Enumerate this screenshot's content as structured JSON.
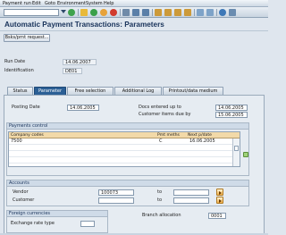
{
  "menu": [
    "Payment run",
    "Edit",
    "Goto",
    "Environment",
    "System",
    "Help"
  ],
  "toolbar": {
    "icons": [
      "enter-icon",
      "save-icon",
      "back-icon",
      "exit-icon",
      "cancel-icon",
      "print-icon",
      "find-icon",
      "find-next-icon",
      "first-page-icon",
      "previous-page-icon",
      "next-page-icon",
      "last-page-icon",
      "new-session-icon",
      "shortcut-icon",
      "help-icon",
      "layout-icon"
    ]
  },
  "title": "Automatic Payment Transactions: Parameters",
  "app_toolbar": {
    "print_request_label": "Bsks/prnt request..."
  },
  "header": {
    "run_date_label": "Run Date",
    "run_date_value": "14.06.2007",
    "identification_label": "Identification",
    "identification_value": "DE01"
  },
  "tabs": [
    {
      "label": "Status",
      "active": false
    },
    {
      "label": "Parameter",
      "active": true
    },
    {
      "label": "Free selection",
      "active": false
    },
    {
      "label": "Additional Log",
      "active": false
    },
    {
      "label": "Printout/data medium",
      "active": false
    }
  ],
  "params": {
    "posting_date_label": "Posting Date",
    "posting_date_value": "14.06.2005",
    "docs_entered_label": "Docs entered up to",
    "docs_entered_value": "14.06.2005",
    "customer_items_label": "Customer items due by",
    "customer_items_value": "15.06.2005"
  },
  "payments_control": {
    "title": "Payments control",
    "columns": [
      "Company codes",
      "Pmt meths",
      "Next p/date"
    ],
    "rows": [
      {
        "company_codes": "7500",
        "pmt_meths": "C",
        "next_pdate": "16.06.2005"
      }
    ]
  },
  "accounts": {
    "title": "Accounts",
    "vendor_label": "Vendor",
    "vendor_from": "100073",
    "vendor_to": "",
    "customer_label": "Customer",
    "customer_from": "",
    "customer_to": "",
    "to_label": "to"
  },
  "foreign_currencies": {
    "title": "Foreign currencies",
    "exchange_rate_type_label": "Exchange rate type",
    "exchange_rate_type_value": ""
  },
  "branch": {
    "label": "Branch allocation",
    "value": "0001"
  },
  "colors": {
    "active_tab": "#2b5f95",
    "table_header": "#f2d9a8",
    "title": "#18325a"
  }
}
